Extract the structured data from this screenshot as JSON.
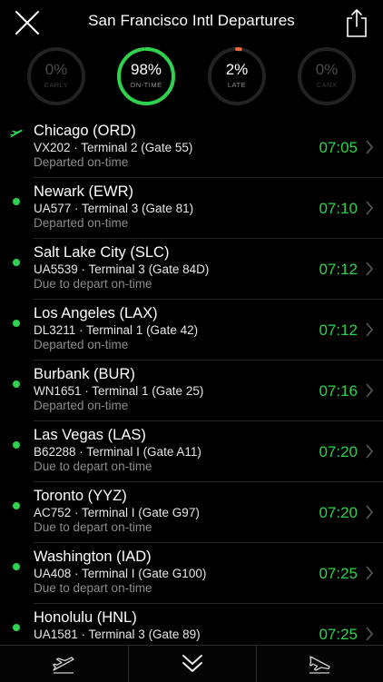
{
  "header": {
    "title": "San Francisco Intl Departures"
  },
  "stats": [
    {
      "pct": "0%",
      "label": "EARLY",
      "fraction": 0,
      "color": "#2b2b2b",
      "text_color": "#4a4a4a",
      "label_color": "#3a3a3a"
    },
    {
      "pct": "98%",
      "label": "ON-TIME",
      "fraction": 0.98,
      "color": "#2ed24d",
      "text_color": "#ffffff",
      "label_color": "#8a8a8a"
    },
    {
      "pct": "2%",
      "label": "LATE",
      "fraction": 0.02,
      "color": "#f26a3d",
      "text_color": "#ffffff",
      "label_color": "#8a8a8a"
    },
    {
      "pct": "0%",
      "label": "CANX",
      "fraction": 0,
      "color": "#2b2b2b",
      "text_color": "#4a4a4a",
      "label_color": "#3a3a3a"
    }
  ],
  "flights": [
    {
      "city": "Chicago (ORD)",
      "flight": "VX202 · Terminal 2 (Gate 55)",
      "status": "Departed on-time",
      "time": "07:05",
      "icon": "plane-departed"
    },
    {
      "city": "Newark (EWR)",
      "flight": "UA577 · Terminal 3 (Gate 81)",
      "status": "Departed on-time",
      "time": "07:10",
      "icon": "dot"
    },
    {
      "city": "Salt Lake City (SLC)",
      "flight": "UA5539 · Terminal 3 (Gate 84D)",
      "status": "Due to depart on-time",
      "time": "07:12",
      "icon": "dot"
    },
    {
      "city": "Los Angeles (LAX)",
      "flight": "DL3211 · Terminal 1 (Gate 42)",
      "status": "Departed on-time",
      "time": "07:12",
      "icon": "dot"
    },
    {
      "city": "Burbank (BUR)",
      "flight": "WN1651 · Terminal 1 (Gate 25)",
      "status": "Departed on-time",
      "time": "07:16",
      "icon": "dot"
    },
    {
      "city": "Las Vegas (LAS)",
      "flight": "B62288 · Terminal I (Gate A11)",
      "status": "Due to depart on-time",
      "time": "07:20",
      "icon": "dot"
    },
    {
      "city": "Toronto (YYZ)",
      "flight": "AC752 · Terminal I (Gate G97)",
      "status": "Due to depart on-time",
      "time": "07:20",
      "icon": "dot"
    },
    {
      "city": "Washington (IAD)",
      "flight": "UA408 · Terminal I (Gate G100)",
      "status": "Due to depart on-time",
      "time": "07:25",
      "icon": "dot"
    },
    {
      "city": "Honolulu (HNL)",
      "flight": "UA1581 · Terminal 3 (Gate 89)",
      "status": "",
      "time": "07:25",
      "icon": "dot"
    }
  ],
  "tabbar": {
    "tabs": [
      "departures-icon",
      "chevron-double-down-icon",
      "arrivals-icon"
    ]
  },
  "colors": {
    "accent": "#2ed24d",
    "late": "#f26a3d",
    "background": "#000000"
  }
}
